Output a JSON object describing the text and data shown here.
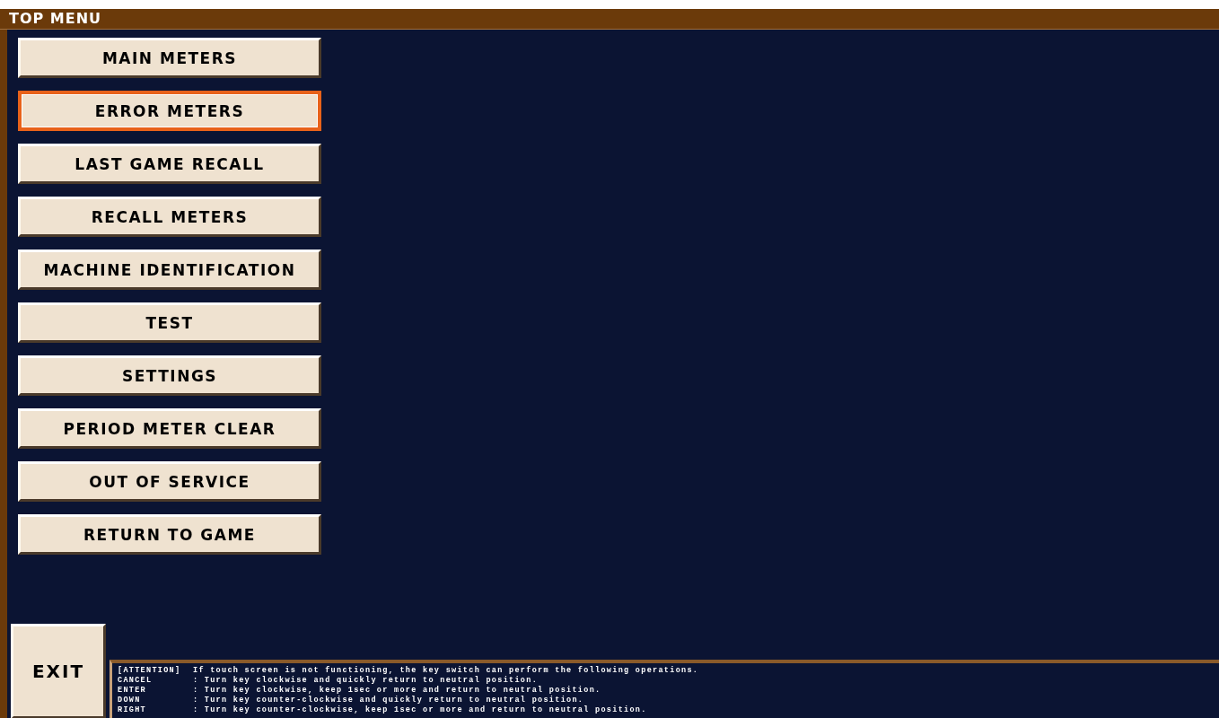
{
  "title": "TOP MENU",
  "menu": [
    {
      "label": "MAIN METERS",
      "selected": false
    },
    {
      "label": "ERROR METERS",
      "selected": true
    },
    {
      "label": "LAST GAME RECALL",
      "selected": false
    },
    {
      "label": "RECALL METERS",
      "selected": false
    },
    {
      "label": "MACHINE IDENTIFICATION",
      "selected": false
    },
    {
      "label": "TEST",
      "selected": false
    },
    {
      "label": "SETTINGS",
      "selected": false
    },
    {
      "label": "PERIOD METER CLEAR",
      "selected": false
    },
    {
      "label": "OUT OF SERVICE",
      "selected": false
    },
    {
      "label": "RETURN TO GAME",
      "selected": false
    }
  ],
  "exit_button": "EXIT",
  "info": [
    {
      "key": "[ATTENTION]",
      "text": "If touch screen is not functioning, the key switch can perform the following operations."
    },
    {
      "key": "CANCEL",
      "text": ": Turn key clockwise and quickly return to neutral position."
    },
    {
      "key": "ENTER",
      "text": ": Turn key clockwise, keep 1sec or more and return to neutral position."
    },
    {
      "key": "DOWN",
      "text": ": Turn key counter-clockwise and quickly return to neutral position."
    },
    {
      "key": "RIGHT",
      "text": ": Turn key counter-clockwise, keep 1sec or more and return to neutral position."
    }
  ]
}
